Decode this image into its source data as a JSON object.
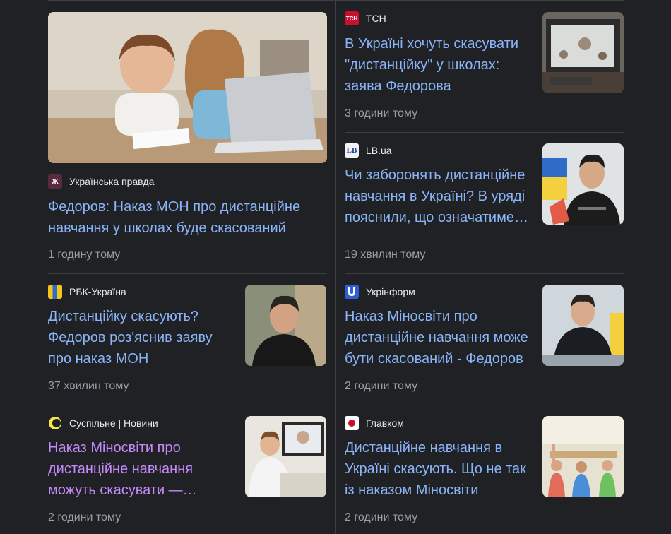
{
  "articles": [
    {
      "source": "ТСН",
      "title": "В Україні хочуть скасувати \"дистанційку\" у школах: заява Федорова",
      "time": "3 години тому"
    },
    {
      "source": "Українська правда",
      "title": "Федоров: Наказ МОН про дистанційне навчання у школах буде скасований",
      "time": "1 годину тому"
    },
    {
      "source": "LB.ua",
      "title": "Чи заборонять дистанційне навчання в Україні? В уряді пояснили, що означатиме…",
      "time": "19 хвилин тому"
    },
    {
      "source": "РБК-Україна",
      "title": "Дистанційку скасують? Федоров роз'яснив заяву про наказ МОН",
      "time": "37 хвилин тому"
    },
    {
      "source": "Укрінформ",
      "title": "Наказ Міносвіти про дистанційне навчання може бути скасований - Федоров",
      "time": "2 години тому"
    },
    {
      "source": "Суспільне | Новини",
      "title": "Наказ Міносвіти про дистанційне навчання можуть скасувати —…",
      "time": "2 години тому"
    },
    {
      "source": "Главком",
      "title": "Дистанційне навчання в Україні скасують. Що не так із наказом Міносвіти",
      "time": "2 години тому"
    }
  ],
  "logos": {
    "tsn": "ТСН",
    "up": "Ж",
    "lb": "LB"
  },
  "colors": {
    "link": "#8ab4f8",
    "visited_link": "#c58af9",
    "meta": "#9aa0a6",
    "background": "#202124",
    "divider": "#3c4043"
  }
}
